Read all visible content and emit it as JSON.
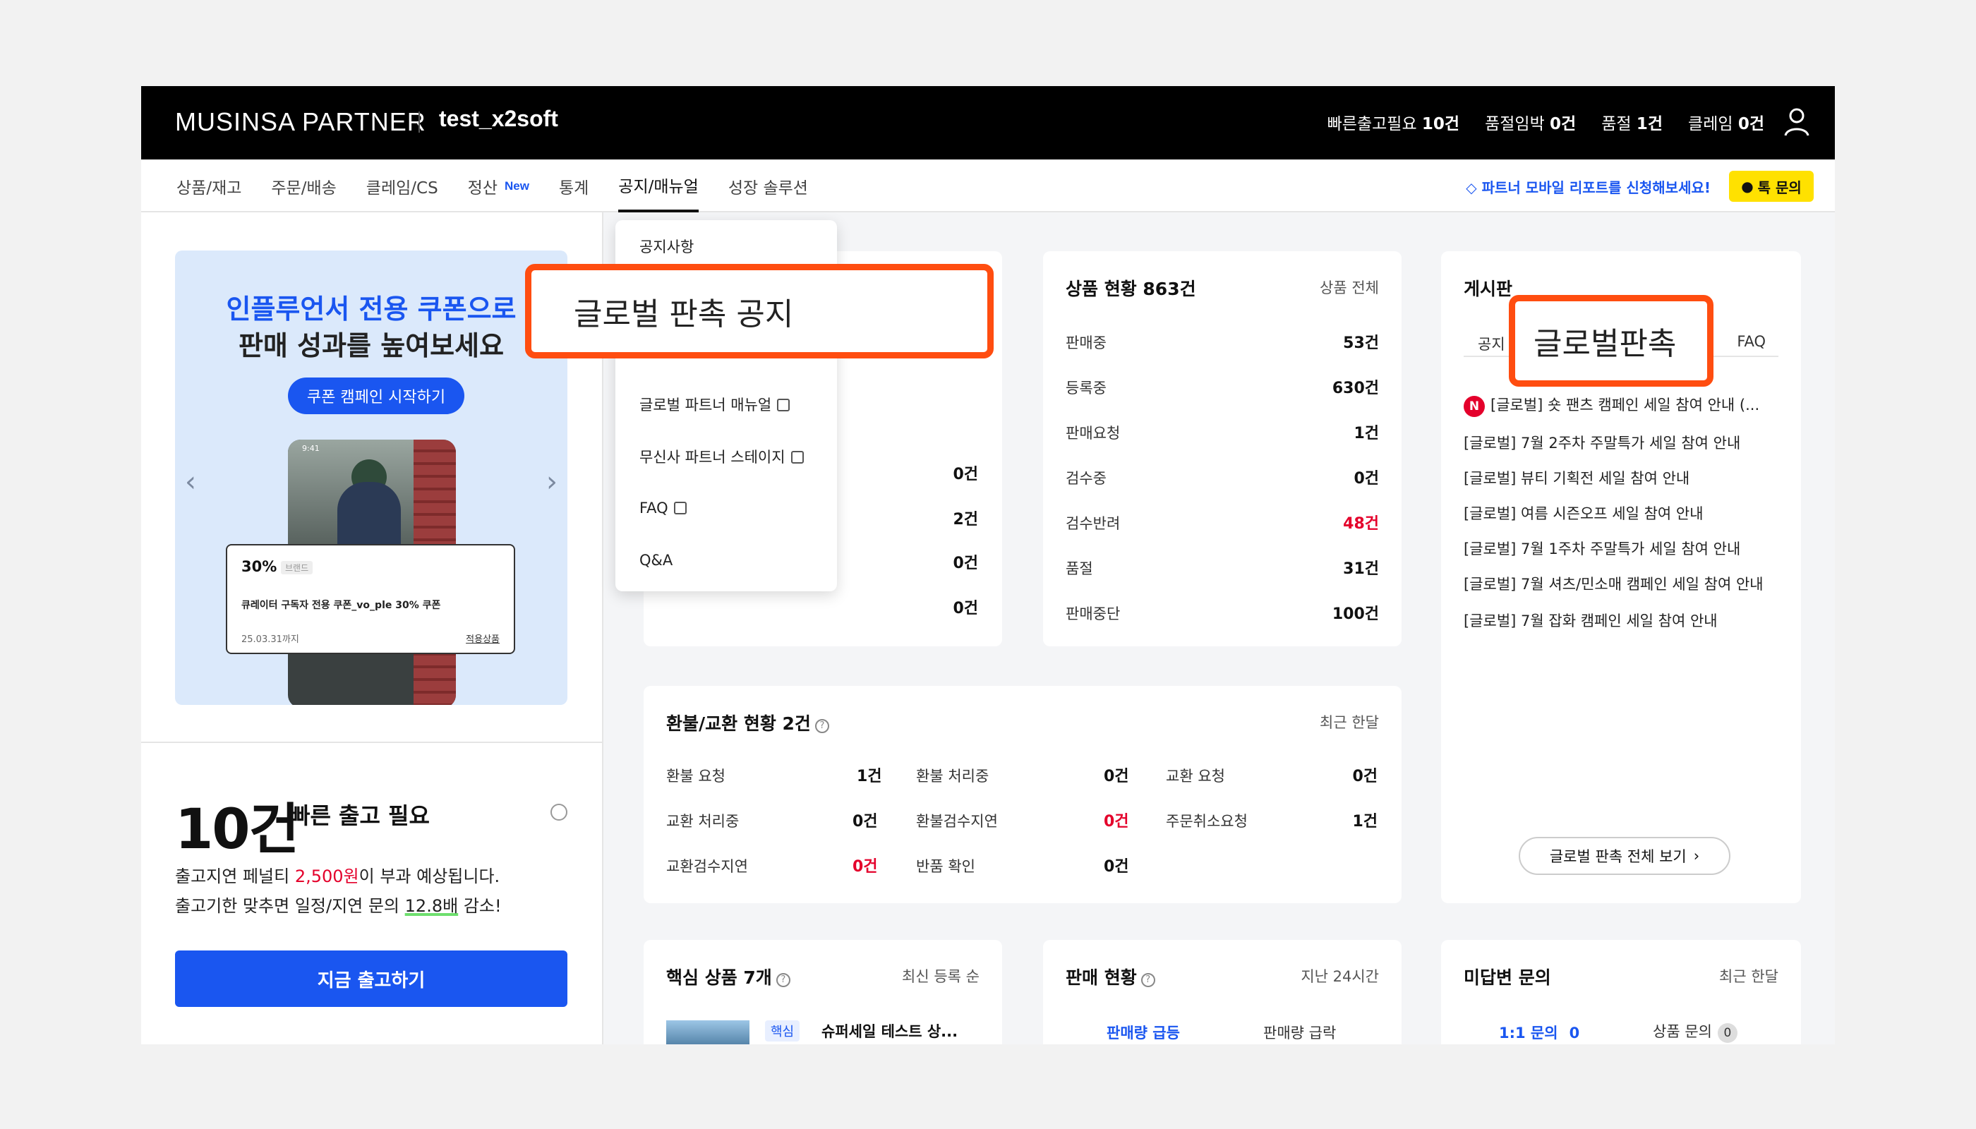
{
  "header": {
    "logo": "MUSINSA PARTNER",
    "store": "test_x2soft",
    "stats": [
      {
        "label": "빠른출고필요",
        "value": "10건"
      },
      {
        "label": "품절임박",
        "value": "0건"
      },
      {
        "label": "품절",
        "value": "1건"
      },
      {
        "label": "클레임",
        "value": "0건"
      }
    ]
  },
  "nav": {
    "items": [
      "상품/재고",
      "주문/배송",
      "클레임/CS",
      "정산",
      "통계",
      "공지/매뉴얼",
      "성장 솔루션"
    ],
    "new_badge": "New",
    "promo": "파트너 모바일 리포트를 신청해보세요!",
    "talk": "톡 문의"
  },
  "dropdown": {
    "items": [
      "공지사항",
      "글로벌 파트너 매뉴얼",
      "무신사 파트너 스테이지",
      "FAQ",
      "Q&A"
    ]
  },
  "callouts": {
    "dropdown": "글로벌 판촉 공지",
    "board_tab": "글로벌판촉"
  },
  "banner": {
    "line1": "인플루언서 전용 쿠폰으로",
    "line2": "판매 성과를 높여보세요",
    "button": "쿠폰 캠페인 시작하기",
    "coupon_pct": "30%",
    "coupon_tag": "브랜드",
    "coupon_name": "큐레이터 구독자 전용 쿠폰_vo_ple 30% 쿠폰",
    "coupon_date": "25.03.31까지",
    "coupon_link": "적용상품",
    "phone_time": "9:41"
  },
  "shipping": {
    "count": "10건",
    "label": "빠른 출고 필요",
    "desc1_pre": "출고지연 페널티 ",
    "desc1_amount": "2,500원",
    "desc1_post": "이 부과 예상됩니다.",
    "desc2_pre": "출고기한 맞추면 일정/지연 문의 ",
    "desc2_mult": "12.8배",
    "desc2_post": " 감소!",
    "button": "지금 출고하기"
  },
  "order_card_values": [
    "0건",
    "2건",
    "0건",
    "0건"
  ],
  "product_status": {
    "title": "상품 현황 863건",
    "sub": "상품 전체",
    "rows": [
      {
        "label": "판매중",
        "value": "53건"
      },
      {
        "label": "등록중",
        "value": "630건"
      },
      {
        "label": "판매요청",
        "value": "1건"
      },
      {
        "label": "검수중",
        "value": "0건"
      },
      {
        "label": "검수반려",
        "value": "48건"
      },
      {
        "label": "품절",
        "value": "31건"
      },
      {
        "label": "판매중단",
        "value": "100건"
      }
    ]
  },
  "board": {
    "title": "게시판",
    "tab_notice": "공지",
    "tab_faq": "FAQ",
    "new_mark": "N",
    "items": [
      "[글로벌] 숏 팬츠 캠페인 세일 참여 안내 (...",
      "[글로벌] 7월 2주차 주말특가 세일 참여 안내",
      "[글로벌] 뷰티 기획전 세일 참여 안내",
      "[글로벌] 여름 시즌오프 세일 참여 안내",
      "[글로벌] 7월 1주차 주말특가 세일 참여 안내",
      "[글로벌] 7월 셔츠/민소매 캠페인 세일 참여 안내",
      "[글로벌] 7월 잡화 캠페인 세일 참여 안내"
    ],
    "all_button": "글로벌 판촉 전체 보기"
  },
  "refund": {
    "title": "환불/교환 현황 2건",
    "sub": "최근 한달",
    "cells": [
      {
        "label": "환불 요청",
        "value": "1건",
        "alert": false
      },
      {
        "label": "환불 처리중",
        "value": "0건",
        "alert": false
      },
      {
        "label": "교환 요청",
        "value": "0건",
        "alert": false
      },
      {
        "label": "교환 처리중",
        "value": "0건",
        "alert": false
      },
      {
        "label": "환불검수지연",
        "value": "0건",
        "alert": true
      },
      {
        "label": "주문취소요청",
        "value": "1건",
        "alert": false
      },
      {
        "label": "교환검수지연",
        "value": "0건",
        "alert": true
      },
      {
        "label": "반품 확인",
        "value": "0건",
        "alert": false
      }
    ]
  },
  "core_products": {
    "title": "핵심 상품 7개",
    "sub": "최신 등록 순",
    "tag": "핵심",
    "item": "슈퍼세일 테스트 상..."
  },
  "sales": {
    "title": "판매 현황",
    "sub": "지난 24시간",
    "tab1": "판매량 급등",
    "tab2": "판매량 급락"
  },
  "inquiry": {
    "title": "미답변 문의",
    "sub": "최근 한달",
    "tab1": "1:1 문의",
    "tab1_count": "0",
    "tab2": "상품 문의",
    "tab2_count": "0"
  },
  "colors": {
    "accent": "#1a56f0",
    "alert": "#e4002b",
    "callout": "#ff4d10",
    "talk": "#ffe100"
  }
}
